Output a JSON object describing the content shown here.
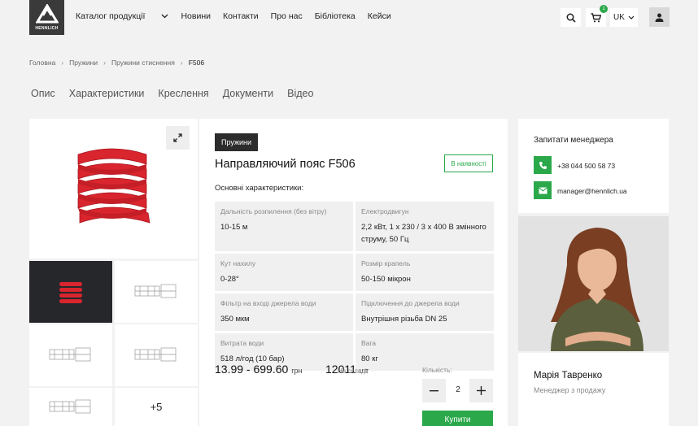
{
  "header": {
    "logo_text": "HENNLICH",
    "nav": [
      "Каталог продукції",
      "Новини",
      "Контакти",
      "Про нас",
      "Бібліотека",
      "Кейси"
    ],
    "cart_count": "1",
    "language": "UK"
  },
  "breadcrumb": [
    "Головна",
    "Пружини",
    "Пружини стиснення",
    "F506"
  ],
  "tabs": [
    "Опис",
    "Характеристики",
    "Креслення",
    "Документи",
    "Відео"
  ],
  "gallery": {
    "more_label": "+5"
  },
  "product": {
    "category": "Пружини",
    "title": "Направляючий пояс F506",
    "stock_badge": "В наявності",
    "main_chars_title": "Основні характеристики:",
    "specs": [
      {
        "label": "Дальність розпилення (без вітру)",
        "value": "10-15 м"
      },
      {
        "label": "Електродвигун",
        "value": "2,2 кВт, 1 х 230 / 3 х 400 В змінного струму, 50 Гц"
      },
      {
        "label": "Кут нахилу",
        "value": "0-28°"
      },
      {
        "label": "Розмір крапель",
        "value": "50-150 мікрон"
      },
      {
        "label": "Фільтр на вході джерела води",
        "value": "350 мкм"
      },
      {
        "label": "Підключення до джерела води",
        "value": "Внутрішня різьба DN 25"
      },
      {
        "label": "Витрата води",
        "value": "518 л/год (10 бар)"
      },
      {
        "label": "Вага",
        "value": "80 кг"
      }
    ],
    "price": "13.99 - 699.60",
    "price_unit": "грн",
    "stock_qty": "12011",
    "stock_unit": "шт",
    "stock_label": "На складі:",
    "qty_label": "Кількість:",
    "qty_value": "2",
    "buy_label": "Купити"
  },
  "manager": {
    "box_title": "Запитати менеджера",
    "phone": "+38 044 500 58 73",
    "email": "manager@hennlich.ua",
    "name": "Марія Тавренко",
    "role": "Менеджер з продажу"
  },
  "colors": {
    "accent": "#2aa84a",
    "dark": "#2c2c2c",
    "background": "#f2f2f2",
    "product_red": "#d9252e"
  }
}
